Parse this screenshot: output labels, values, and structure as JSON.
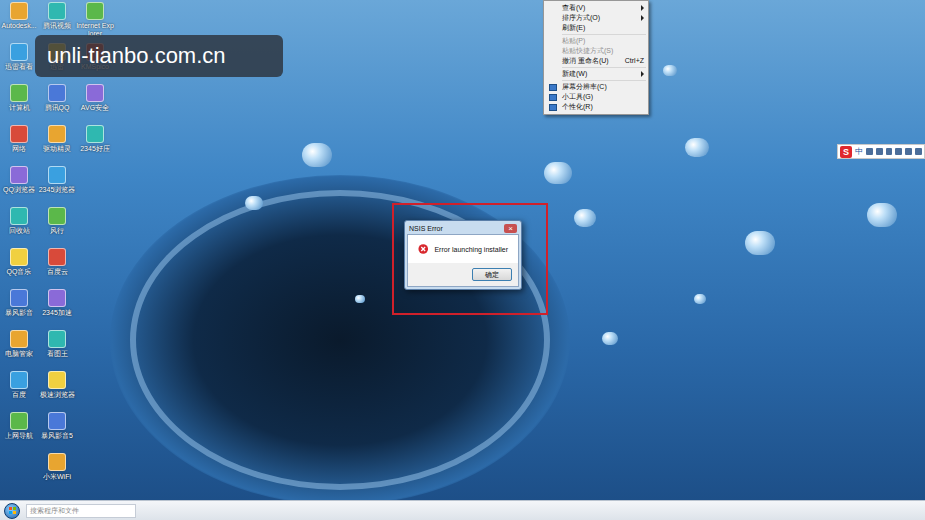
{
  "window": {
    "title": "Windows 7 桌面"
  },
  "watermark": "unli-tianbo.com.cn",
  "icon_columns": [
    [
      "Autodesk...",
      "迅雷看看",
      "计算机",
      "网络",
      "QQ浏览器",
      "回收站",
      "QQ音乐",
      "暴风影音",
      "电脑管家",
      "百度",
      "上网导航"
    ],
    [
      "腾讯视频",
      "迅雷",
      "腾讯QQ",
      "驱动精灵",
      "2345浏览器",
      "风行",
      "百度云",
      "2345加速",
      "看图王",
      "极速浏览器",
      "暴风影音5",
      "小米WiFi"
    ],
    [
      "Internet Explorer",
      "KMSpico",
      "AVG安全",
      "2345好压"
    ]
  ],
  "context_menu": {
    "items": [
      {
        "kind": "item",
        "label": "查看(V)",
        "shortcut": "",
        "submenu": true,
        "disabled": false
      },
      {
        "kind": "item",
        "label": "排序方式(O)",
        "shortcut": "",
        "submenu": true,
        "disabled": false
      },
      {
        "kind": "item",
        "label": "刷新(E)",
        "shortcut": "",
        "submenu": false,
        "disabled": false
      },
      {
        "kind": "separator",
        "label": "",
        "shortcut": "",
        "submenu": false,
        "disabled": false
      },
      {
        "kind": "item",
        "label": "粘贴(P)",
        "shortcut": "",
        "submenu": false,
        "disabled": true
      },
      {
        "kind": "item",
        "label": "粘贴快捷方式(S)",
        "shortcut": "",
        "submenu": false,
        "disabled": true
      },
      {
        "kind": "item",
        "label": "撤消 重命名(U)",
        "shortcut": "Ctrl+Z",
        "submenu": false,
        "disabled": false
      },
      {
        "kind": "separator",
        "label": "",
        "shortcut": "",
        "submenu": false,
        "disabled": false
      },
      {
        "kind": "item",
        "label": "新建(W)",
        "shortcut": "",
        "submenu": true,
        "disabled": false
      },
      {
        "kind": "separator",
        "label": "",
        "shortcut": "",
        "submenu": false,
        "disabled": false
      },
      {
        "kind": "icon-item",
        "label": "屏幕分辨率(C)",
        "shortcut": "",
        "submenu": false,
        "disabled": false
      },
      {
        "kind": "icon-item",
        "label": "小工具(G)",
        "shortcut": "",
        "submenu": false,
        "disabled": false
      },
      {
        "kind": "icon-item",
        "label": "个性化(R)",
        "shortcut": "",
        "submenu": false,
        "disabled": false
      }
    ]
  },
  "dialog": {
    "title": "NSIS Error",
    "close": "×",
    "message": "Error launching installer",
    "buttons": [
      "确定"
    ],
    "highlighted": true
  },
  "ime_bar": {
    "logo": "S",
    "mode": "中"
  },
  "taskbar": {
    "search_placeholder": "搜索程序和文件"
  }
}
